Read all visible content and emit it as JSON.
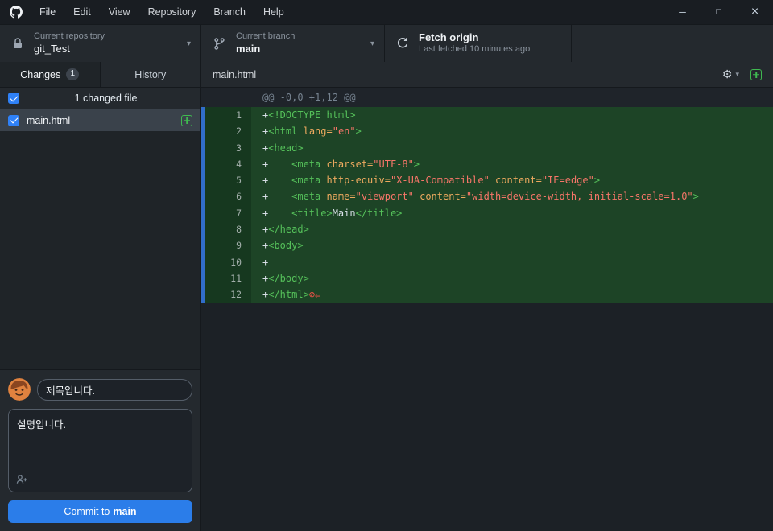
{
  "titlebar": {
    "menus": [
      {
        "label": "File"
      },
      {
        "label": "Edit"
      },
      {
        "label": "View"
      },
      {
        "label": "Repository"
      },
      {
        "label": "Branch"
      },
      {
        "label": "Help"
      }
    ],
    "window_controls": {
      "minimize": "─",
      "maximize": "□",
      "close": "×"
    }
  },
  "toolbar": {
    "repository": {
      "label": "Current repository",
      "value": "git_Test"
    },
    "branch": {
      "label": "Current branch",
      "value": "main"
    },
    "fetch": {
      "title": "Fetch origin",
      "subtitle": "Last fetched 10 minutes ago"
    }
  },
  "sidebar": {
    "tabs": {
      "changes": {
        "label": "Changes",
        "badge": "1"
      },
      "history": {
        "label": "History"
      }
    },
    "summary": "1 changed file",
    "files": [
      {
        "name": "main.html",
        "status": "added",
        "checked": true
      }
    ],
    "commit": {
      "title_value": "제목입니다.",
      "description_value": "설명입니다.",
      "button_prefix": "Commit to",
      "button_branch": "main"
    }
  },
  "diff": {
    "file_name": "main.html",
    "hunk_header": "@@ -0,0 +1,12 @@",
    "lines": [
      {
        "num": 1,
        "segments": [
          {
            "t": "+",
            "c": "p"
          },
          {
            "t": "<!DOCTYPE html>",
            "c": "t"
          }
        ]
      },
      {
        "num": 2,
        "segments": [
          {
            "t": "+",
            "c": "p"
          },
          {
            "t": "<html ",
            "c": "t"
          },
          {
            "t": "lang=",
            "c": "a"
          },
          {
            "t": "\"en\"",
            "c": "s"
          },
          {
            "t": ">",
            "c": "t"
          }
        ]
      },
      {
        "num": 3,
        "segments": [
          {
            "t": "+",
            "c": "p"
          },
          {
            "t": "<head>",
            "c": "t"
          }
        ]
      },
      {
        "num": 4,
        "segments": [
          {
            "t": "+    ",
            "c": "p"
          },
          {
            "t": "<meta ",
            "c": "t"
          },
          {
            "t": "charset=",
            "c": "a"
          },
          {
            "t": "\"UTF-8\"",
            "c": "s"
          },
          {
            "t": ">",
            "c": "t"
          }
        ]
      },
      {
        "num": 5,
        "segments": [
          {
            "t": "+    ",
            "c": "p"
          },
          {
            "t": "<meta ",
            "c": "t"
          },
          {
            "t": "http-equiv=",
            "c": "a"
          },
          {
            "t": "\"X-UA-Compatible\"",
            "c": "s"
          },
          {
            "t": " ",
            "c": "p"
          },
          {
            "t": "content=",
            "c": "a"
          },
          {
            "t": "\"IE=edge\"",
            "c": "s"
          },
          {
            "t": ">",
            "c": "t"
          }
        ]
      },
      {
        "num": 6,
        "segments": [
          {
            "t": "+    ",
            "c": "p"
          },
          {
            "t": "<meta ",
            "c": "t"
          },
          {
            "t": "name=",
            "c": "a"
          },
          {
            "t": "\"viewport\"",
            "c": "s"
          },
          {
            "t": " ",
            "c": "p"
          },
          {
            "t": "content=",
            "c": "a"
          },
          {
            "t": "\"width=device-width, initial-scale=1.0\"",
            "c": "s"
          },
          {
            "t": ">",
            "c": "t"
          }
        ]
      },
      {
        "num": 7,
        "segments": [
          {
            "t": "+    ",
            "c": "p"
          },
          {
            "t": "<title>",
            "c": "t"
          },
          {
            "t": "Main",
            "c": "p"
          },
          {
            "t": "</title>",
            "c": "t"
          }
        ]
      },
      {
        "num": 8,
        "segments": [
          {
            "t": "+",
            "c": "p"
          },
          {
            "t": "</head>",
            "c": "t"
          }
        ]
      },
      {
        "num": 9,
        "segments": [
          {
            "t": "+",
            "c": "p"
          },
          {
            "t": "<body>",
            "c": "t"
          }
        ]
      },
      {
        "num": 10,
        "segments": [
          {
            "t": "+",
            "c": "p"
          }
        ]
      },
      {
        "num": 11,
        "segments": [
          {
            "t": "+",
            "c": "p"
          },
          {
            "t": "</body>",
            "c": "t"
          }
        ]
      },
      {
        "num": 12,
        "segments": [
          {
            "t": "+",
            "c": "p"
          },
          {
            "t": "</html>",
            "c": "t"
          },
          {
            "t": "⊘↵",
            "c": "x"
          }
        ]
      }
    ]
  },
  "icons": {
    "gear": "⚙",
    "caret_down": "▾"
  },
  "colors": {
    "accent_blue": "#2f81f7",
    "commit_button_blue": "#2b7de9",
    "addition_code_bg": "#1d4426",
    "addition_gutter_bg": "#16381f",
    "line_select_strip": "#316dca",
    "added_icon_green": "#3fb950",
    "syntax_tag": "#55c05a",
    "syntax_attr": "#eda95f",
    "syntax_string": "#f77669",
    "no_newline_red": "#f85149"
  }
}
